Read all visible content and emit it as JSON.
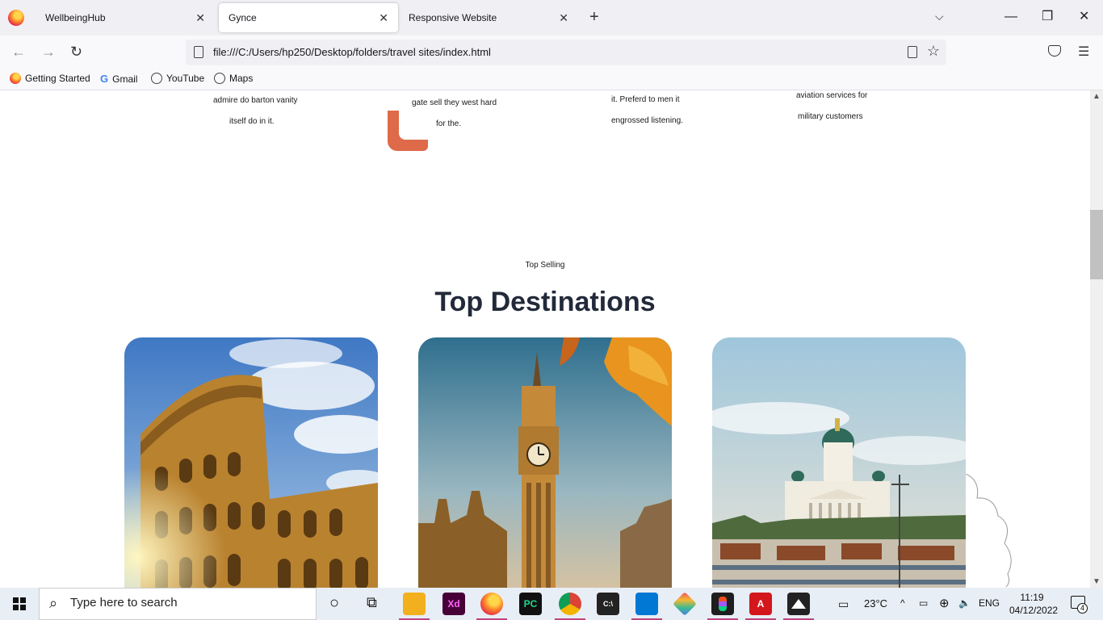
{
  "browser": {
    "tabs": [
      {
        "label": "WellbeingHub"
      },
      {
        "label": "Gynce"
      },
      {
        "label": "Responsive Website"
      }
    ],
    "url": "file:///C:/Users/hp250/Desktop/folders/travel sites/index.html",
    "bookmarks": [
      {
        "label": "Getting Started",
        "icon": "firefox-icon"
      },
      {
        "label": "Gmail",
        "icon": "google-icon"
      },
      {
        "label": "YouTube",
        "icon": "globe-icon"
      },
      {
        "label": "Maps",
        "icon": "globe-icon"
      }
    ]
  },
  "page": {
    "services_text": [
      {
        "line1": "admire do barton vanity",
        "line2": "itself do in it."
      },
      {
        "line1": "gate sell they west hard",
        "line2": "for the."
      },
      {
        "line1": "it. Preferd to men it",
        "line2": "engrossed listening."
      },
      {
        "line1": "aviation services for",
        "line2": "military customers"
      }
    ],
    "kicker": "Top Selling",
    "heading": "Top Destinations",
    "destinations": [
      {
        "name": "colosseum-image"
      },
      {
        "name": "big-ben-image"
      },
      {
        "name": "helsinki-cathedral-image"
      }
    ],
    "accent_color": "#de6a4a"
  },
  "taskbar": {
    "search_placeholder": "Type here to search",
    "weather": "23°C",
    "language": "ENG",
    "time": "11:19",
    "date": "04/12/2022",
    "notification_count": "4"
  }
}
